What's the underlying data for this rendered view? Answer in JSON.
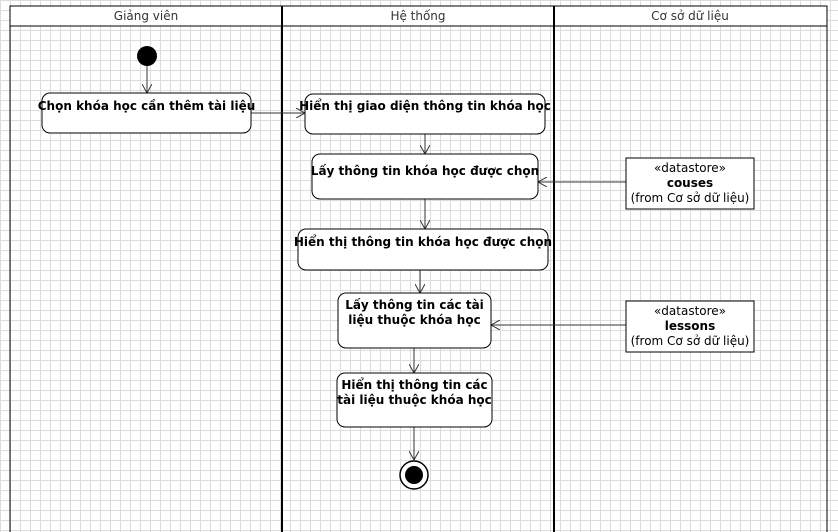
{
  "lanes": [
    "Giảng viên",
    "Hệ thống",
    "Cơ sở dữ liệu"
  ],
  "actions": [
    [
      "Chọn khóa học cần thêm tài liệu"
    ],
    [
      "Hiển thị giao diện thông tin khóa học"
    ],
    [
      "Lấy thông tin khóa học được chọn"
    ],
    [
      "Hiển thị thông tin khóa học được chọn"
    ],
    [
      "Lấy thông tin các tài",
      "liệu thuộc khóa học"
    ],
    [
      "Hiển thị thông tin các",
      "tài liệu thuộc khóa học"
    ]
  ],
  "datastores": [
    {
      "stereotype": "«datastore»",
      "name": "couses",
      "source": "(from Cơ sở dữ liệu)"
    },
    {
      "stereotype": "«datastore»",
      "name": "lessons",
      "source": "(from Cơ sở dữ liệu)"
    }
  ],
  "colors": {
    "line": "#333333",
    "box_stroke": "#000000",
    "fill": "#ffffff",
    "node": "#000000"
  }
}
